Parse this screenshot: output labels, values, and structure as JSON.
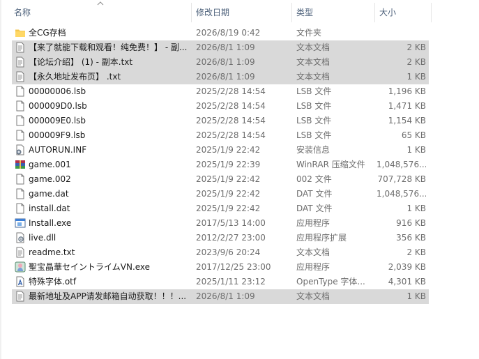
{
  "columns": {
    "name": "名称",
    "date": "修改日期",
    "type": "类型",
    "size": "大小"
  },
  "files": [
    {
      "name": "全CG存档",
      "date": "2026/8/19 0:42",
      "type": "文件夹",
      "size": "",
      "icon": "folder-icon",
      "selected": false
    },
    {
      "name": "【来了就能下载和观看！纯免费！】 - 副...",
      "date": "2026/8/1 1:09",
      "type": "文本文档",
      "size": "2 KB",
      "icon": "text-file-icon",
      "selected": true
    },
    {
      "name": "【论坛介绍】 (1) - 副本.txt",
      "date": "2026/8/1 1:09",
      "type": "文本文档",
      "size": "2 KB",
      "icon": "text-file-icon",
      "selected": true
    },
    {
      "name": "【永久地址发布页】 .txt",
      "date": "2026/8/1 1:09",
      "type": "文本文档",
      "size": "1 KB",
      "icon": "text-file-icon",
      "selected": true
    },
    {
      "name": "00000006.lsb",
      "date": "2025/2/28 14:54",
      "type": "LSB 文件",
      "size": "1,196 KB",
      "icon": "file-icon",
      "selected": false
    },
    {
      "name": "000009D0.lsb",
      "date": "2025/2/28 14:54",
      "type": "LSB 文件",
      "size": "1,471 KB",
      "icon": "file-icon",
      "selected": false
    },
    {
      "name": "000009E0.lsb",
      "date": "2025/2/28 14:54",
      "type": "LSB 文件",
      "size": "1,154 KB",
      "icon": "file-icon",
      "selected": false
    },
    {
      "name": "000009F9.lsb",
      "date": "2025/2/28 14:54",
      "type": "LSB 文件",
      "size": "65 KB",
      "icon": "file-icon",
      "selected": false
    },
    {
      "name": "AUTORUN.INF",
      "date": "2025/1/9 22:42",
      "type": "安装信息",
      "size": "1 KB",
      "icon": "settings-file-icon",
      "selected": false
    },
    {
      "name": "game.001",
      "date": "2025/1/9 22:39",
      "type": "WinRAR 压缩文件",
      "size": "1,048,576...",
      "icon": "winrar-archive-icon",
      "selected": false
    },
    {
      "name": "game.002",
      "date": "2025/1/9 22:42",
      "type": "002 文件",
      "size": "707,728 KB",
      "icon": "file-icon",
      "selected": false
    },
    {
      "name": "game.dat",
      "date": "2025/1/9 22:42",
      "type": "DAT 文件",
      "size": "1,048,576...",
      "icon": "file-icon",
      "selected": false
    },
    {
      "name": "install.dat",
      "date": "2025/1/9 22:42",
      "type": "DAT 文件",
      "size": "1 KB",
      "icon": "file-icon",
      "selected": false
    },
    {
      "name": "Install.exe",
      "date": "2017/5/13 14:00",
      "type": "应用程序",
      "size": "916 KB",
      "icon": "application-icon",
      "selected": false
    },
    {
      "name": "live.dll",
      "date": "2012/2/27 23:00",
      "type": "应用程序扩展",
      "size": "356 KB",
      "icon": "dll-file-icon",
      "selected": false
    },
    {
      "name": "readme.txt",
      "date": "2023/9/6 20:24",
      "type": "文本文档",
      "size": "2 KB",
      "icon": "text-file-icon",
      "selected": false
    },
    {
      "name": "聖宝晶華セイントライムVN.exe",
      "date": "2017/12/25 23:00",
      "type": "应用程序",
      "size": "2,039 KB",
      "icon": "game-exe-icon",
      "selected": false
    },
    {
      "name": "特殊字体.otf",
      "date": "2025/1/11 23:12",
      "type": "OpenType 字体...",
      "size": "4,301 KB",
      "icon": "font-file-icon",
      "selected": false
    },
    {
      "name": "最新地址及APP请发邮箱自动获取！！！...",
      "date": "2026/8/1 1:09",
      "type": "文本文档",
      "size": "1 KB",
      "icon": "text-file-icon",
      "selected": true
    }
  ]
}
